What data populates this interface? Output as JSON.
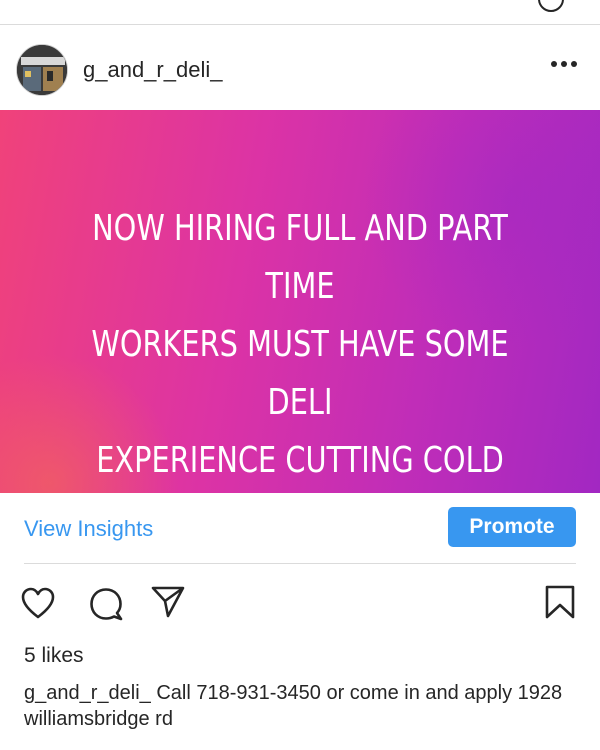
{
  "post": {
    "username": "g_and_r_deli_",
    "image_text_lines": [
      "NOW HIRING FULL AND PART TIME",
      "WORKERS MUST HAVE SOME DELI",
      "EXPERIENCE CUTTING COLD CUTS"
    ],
    "view_insights_label": "View Insights",
    "promote_label": "Promote",
    "likes_text": "5 likes",
    "caption_user": "g_and_r_deli_",
    "caption_text": " Call 718-931-3450 or come in and apply 1928 williamsbridge rd"
  },
  "colors": {
    "link_blue": "#3897f0",
    "gradient_start": "#f0427a",
    "gradient_end": "#a228c2"
  },
  "icons": {
    "more": "more-options-icon",
    "like": "heart-icon",
    "comment": "comment-icon",
    "share": "share-icon",
    "save": "bookmark-icon"
  }
}
